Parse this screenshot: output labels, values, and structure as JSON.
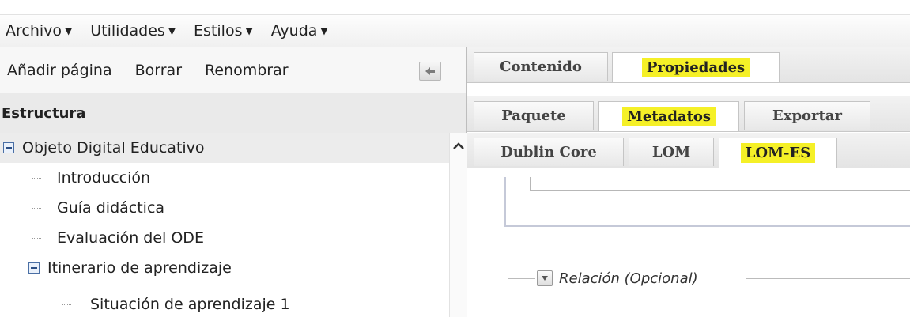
{
  "menu": {
    "items": [
      {
        "label": "Archivo"
      },
      {
        "label": "Utilidades"
      },
      {
        "label": "Estilos"
      },
      {
        "label": "Ayuda"
      }
    ]
  },
  "toolbar": {
    "add_page": "Añadir página",
    "delete": "Borrar",
    "rename": "Renombrar"
  },
  "structure": {
    "title": "Estructura",
    "root": "Objeto Digital Educativo",
    "items": [
      {
        "label": "Introducción"
      },
      {
        "label": "Guía didáctica"
      },
      {
        "label": "Evaluación del ODE"
      },
      {
        "label": "Itinerario de aprendizaje"
      },
      {
        "label": "Situación de aprendizaje 1"
      }
    ]
  },
  "tabs_main": [
    {
      "label": "Contenido"
    },
    {
      "label": "Propiedades"
    }
  ],
  "tabs_props": [
    {
      "label": "Paquete"
    },
    {
      "label": "Metadatos"
    },
    {
      "label": "Exportar"
    }
  ],
  "tabs_meta": [
    {
      "label": "Dublin Core"
    },
    {
      "label": "LOM"
    },
    {
      "label": "LOM-ES"
    }
  ],
  "relation_legend": "Relación (Opcional)",
  "colors": {
    "highlight": "#f5f027",
    "expander_border": "#4a6fa5"
  }
}
